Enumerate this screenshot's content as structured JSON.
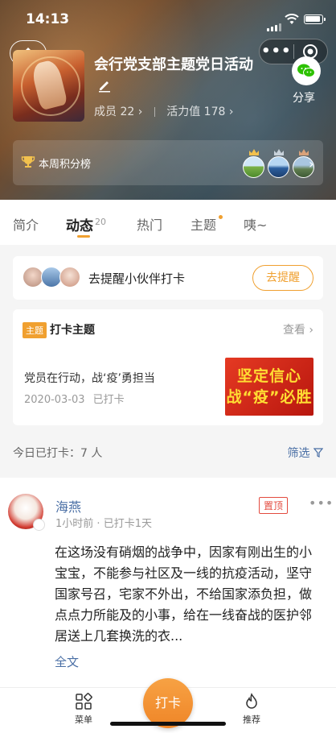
{
  "status": {
    "time": "14:13"
  },
  "group": {
    "title": "会行党支部主题党日活动",
    "members_label": "成员 22",
    "vitality_label": "活力值 178",
    "share_label": "分享",
    "leaderboard_label": "本周积分榜"
  },
  "tabs": [
    {
      "label": "简介"
    },
    {
      "label": "动态",
      "count": "20"
    },
    {
      "label": "热门"
    },
    {
      "label": "主题"
    },
    {
      "label": "咦~"
    }
  ],
  "remind": {
    "text": "去提醒小伙伴打卡",
    "button": "去提醒"
  },
  "topic": {
    "tag": "主题",
    "header": "打卡主题",
    "view": "查看",
    "title": "党员在行动，战‘疫’勇担当",
    "date": "2020-03-03",
    "status": "已打卡",
    "poster_line1": "坚定信心",
    "poster_line2": "战“疫”必胜"
  },
  "checkin": {
    "today": "今日已打卡：7 人",
    "filter": "筛选"
  },
  "post": {
    "author": "海燕",
    "time": "1小时前",
    "streak": "已打卡1天",
    "pinned": "置顶",
    "body": "在这场没有硝烟的战争中，因家有刚出生的小宝宝，不能参与社区及一线的抗疫活动，坚守国家号召，宅家不外出，不给国家添负担，做点点力所能及的小事，给在一线奋战的医护邻居送上几套换洗的衣...",
    "expand": "全文"
  },
  "bottom": {
    "menu": "菜单",
    "checkin": "打卡",
    "recommend": "推荐"
  },
  "colors": {
    "accent": "#f0a030",
    "link": "#4a6fa5",
    "pin": "#e34b3f"
  }
}
